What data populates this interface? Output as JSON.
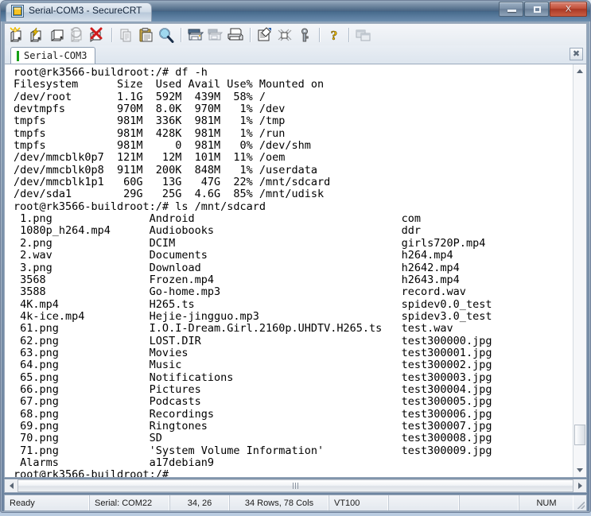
{
  "window": {
    "title": "Serial-COM3 - SecureCRT",
    "icon": "securecrt-app-icon",
    "buttons": {
      "minimize": "minimize",
      "maximize": "maximize",
      "close": "X"
    }
  },
  "toolbar": {
    "items": [
      {
        "name": "connect-icon",
        "label": "Connect"
      },
      {
        "name": "quick-connect-icon",
        "label": "Quick Connect"
      },
      {
        "name": "connect-in-tab-icon",
        "label": "Connect in Tab"
      },
      {
        "name": "reconnect-icon",
        "label": "Reconnect"
      },
      {
        "name": "disconnect-icon",
        "label": "Disconnect"
      },
      {
        "name": "copy-icon",
        "label": "Copy"
      },
      {
        "name": "paste-icon",
        "label": "Paste"
      },
      {
        "name": "find-icon",
        "label": "Find"
      },
      {
        "name": "print-screen-icon",
        "label": "Print Screen"
      },
      {
        "name": "log-session-icon",
        "label": "Log Session"
      },
      {
        "name": "print-icon",
        "label": "Print"
      },
      {
        "name": "session-options-icon",
        "label": "Session Options"
      },
      {
        "name": "global-options-icon",
        "label": "Global Options"
      },
      {
        "name": "key-icon",
        "label": "Key"
      },
      {
        "name": "help-icon",
        "label": "Help"
      },
      {
        "name": "arrange-icon",
        "label": "Arrange"
      }
    ]
  },
  "tabs": {
    "active": "Serial-COM3",
    "close_label": "✖"
  },
  "terminal": {
    "lines": [
      "root@rk3566-buildroot:/# df -h",
      "Filesystem      Size  Used Avail Use% Mounted on",
      "/dev/root       1.1G  592M  439M  58% /",
      "devtmpfs        970M  8.0K  970M   1% /dev",
      "tmpfs           981M  336K  981M   1% /tmp",
      "tmpfs           981M  428K  981M   1% /run",
      "tmpfs           981M     0  981M   0% /dev/shm",
      "/dev/mmcblk0p7  121M   12M  101M  11% /oem",
      "/dev/mmcblk0p8  911M  200K  848M   1% /userdata",
      "/dev/mmcblk1p1   60G   13G   47G  22% /mnt/sdcard",
      "/dev/sda1        29G   25G  4.6G  85% /mnt/udisk",
      "root@rk3566-buildroot:/# ls /mnt/sdcard",
      " 1.png               Android                                com",
      " 1080p_h264.mp4      Audiobooks                             ddr",
      " 2.png               DCIM                                   girls720P.mp4",
      " 2.wav               Documents                              h264.mp4",
      " 3.png               Download                               h2642.mp4",
      " 3568                Frozen.mp4                             h2643.mp4",
      " 3588                Go-home.mp3                            record.wav",
      " 4K.mp4              H265.ts                                spidev0.0_test",
      " 4k-ice.mp4          Hejie-jingguo.mp3                      spidev3.0_test",
      " 61.png              I.O.I-Dream.Girl.2160p.UHDTV.H265.ts   test.wav",
      " 62.png              LOST.DIR                               test300000.jpg",
      " 63.png              Movies                                 test300001.jpg",
      " 64.png              Music                                  test300002.jpg",
      " 65.png              Notifications                          test300003.jpg",
      " 66.png              Pictures                               test300004.jpg",
      " 67.png              Podcasts                               test300005.jpg",
      " 68.png              Recordings                             test300006.jpg",
      " 69.png              Ringtones                              test300007.jpg",
      " 70.png              SD                                     test300008.jpg",
      " 71.png              'System Volume Information'            test300009.jpg",
      " Alarms              a17debian9",
      "root@rk3566-buildroot:/#"
    ],
    "prompt": "root@rk3566-buildroot:/#",
    "commands": [
      "df -h",
      "ls /mnt/sdcard"
    ],
    "disk_usage": {
      "headers": [
        "Filesystem",
        "Size",
        "Used",
        "Avail",
        "Use%",
        "Mounted on"
      ],
      "rows": [
        [
          "/dev/root",
          "1.1G",
          "592M",
          "439M",
          "58%",
          "/"
        ],
        [
          "devtmpfs",
          "970M",
          "8.0K",
          "970M",
          "1%",
          "/dev"
        ],
        [
          "tmpfs",
          "981M",
          "336K",
          "981M",
          "1%",
          "/tmp"
        ],
        [
          "tmpfs",
          "981M",
          "428K",
          "981M",
          "1%",
          "/run"
        ],
        [
          "tmpfs",
          "981M",
          "0",
          "981M",
          "0%",
          "/dev/shm"
        ],
        [
          "/dev/mmcblk0p7",
          "121M",
          "12M",
          "101M",
          "11%",
          "/oem"
        ],
        [
          "/dev/mmcblk0p8",
          "911M",
          "200K",
          "848M",
          "1%",
          "/userdata"
        ],
        [
          "/dev/mmcblk1p1",
          "60G",
          "13G",
          "47G",
          "22%",
          "/mnt/sdcard"
        ],
        [
          "/dev/sda1",
          "29G",
          "25G",
          "4.6G",
          "85%",
          "/mnt/udisk"
        ]
      ]
    },
    "listing": {
      "column1": [
        "1.png",
        "1080p_h264.mp4",
        "2.png",
        "2.wav",
        "3.png",
        "3568",
        "3588",
        "4K.mp4",
        "4k-ice.mp4",
        "61.png",
        "62.png",
        "63.png",
        "64.png",
        "65.png",
        "66.png",
        "67.png",
        "68.png",
        "69.png",
        "70.png",
        "71.png",
        "Alarms"
      ],
      "column2": [
        "Android",
        "Audiobooks",
        "DCIM",
        "Documents",
        "Download",
        "Frozen.mp4",
        "Go-home.mp3",
        "H265.ts",
        "Hejie-jingguo.mp3",
        "I.O.I-Dream.Girl.2160p.UHDTV.H265.ts",
        "LOST.DIR",
        "Movies",
        "Music",
        "Notifications",
        "Pictures",
        "Podcasts",
        "Recordings",
        "Ringtones",
        "SD",
        "'System Volume Information'",
        "a17debian9"
      ],
      "column3": [
        "com",
        "ddr",
        "girls720P.mp4",
        "h264.mp4",
        "h2642.mp4",
        "h2643.mp4",
        "record.wav",
        "spidev0.0_test",
        "spidev3.0_test",
        "test.wav",
        "test300000.jpg",
        "test300001.jpg",
        "test300002.jpg",
        "test300003.jpg",
        "test300004.jpg",
        "test300005.jpg",
        "test300006.jpg",
        "test300007.jpg",
        "test300008.jpg",
        "test300009.jpg"
      ]
    }
  },
  "statusbar": {
    "ready": "Ready",
    "serial": "Serial: COM22",
    "cursor": "34, 26",
    "size": "34 Rows, 78 Cols",
    "emulation": "VT100",
    "blank1": "",
    "blank2": "",
    "num": "NUM"
  },
  "colors": {
    "terminal_bg": "#ffffff",
    "terminal_fg": "#000000",
    "tab_active_mark": "#16a016",
    "close_button": "#c2513b",
    "titlebar": "#3d5b7b"
  }
}
